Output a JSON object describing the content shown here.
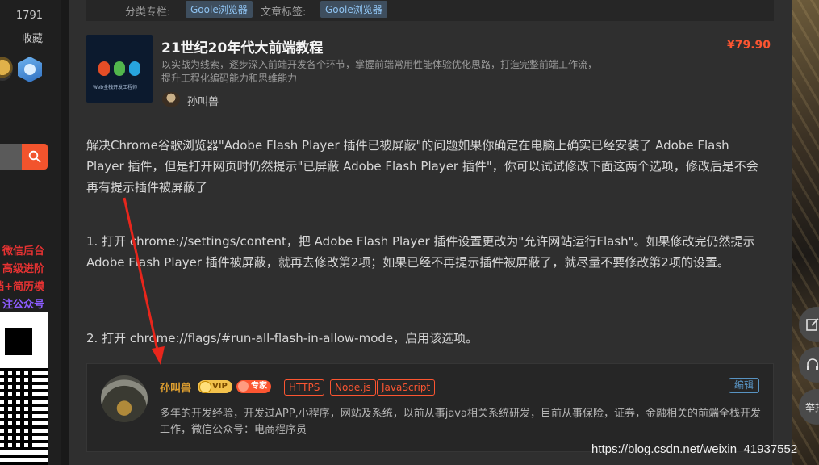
{
  "sidebar": {
    "stat_number": "1791",
    "stat_label": "收藏",
    "promos": [
      "微信后台",
      "高级进阶",
      "档+简历模",
      "注公众号"
    ]
  },
  "article_meta": {
    "category_label": "分类专栏:",
    "category_tag": "Goole浏览器",
    "tags_label": "文章标签:",
    "tag": "Goole浏览器"
  },
  "course": {
    "thumb_caption": "Web全栈开发工程师",
    "title": "21世纪20年代大前端教程",
    "price": "¥79.90",
    "description": "以实战为线索，逐步深入前端开发各个环节，掌握前端常用性能体验优化思路，打造完整前端工作流，提升工程化编码能力和思维能力",
    "author": "孙叫兽"
  },
  "article": {
    "intro": "解决Chrome谷歌浏览器\"Adobe Flash Player 插件已被屏蔽\"的问题如果你确定在电脑上确实已经安装了 Adobe Flash Player 插件，但是打开网页时仍然提示\"已屏蔽 Adobe Flash Player 插件\"，你可以试试修改下面这两个选项，修改后是不会再有提示插件被屏蔽了",
    "step1": "1. 打开 chrome://settings/content，把 Adobe Flash Player 插件设置更改为\"允许网站运行Flash\"。如果修改完仍然提示 Adobe Flash Player 插件被屏蔽，就再去修改第2项；如果已经不再提示插件被屏蔽了，就尽量不要修改第2项的设置。",
    "step2": "2. 打开 chrome://flags/#run-all-flash-in-allow-mode，启用该选项。"
  },
  "author_box": {
    "name": "孙叫兽",
    "vip_badge": "VIP",
    "expert_badge": "专家",
    "skills": [
      "HTTPS",
      "Node.js",
      "JavaScript"
    ],
    "edit_label": "编辑",
    "bio": "多年的开发经验，开发过APP,小程序，网站及系统，以前从事java相关系统研发，目前从事保险，证券，金融相关的前端全栈开发工作，微信公众号：电商程序员"
  },
  "tools": {
    "report_label": "举报"
  },
  "watermark": "https://blog.csdn.net/weixin_41937552",
  "colors": {
    "accent": "#fc5531",
    "link": "#5893c2",
    "arrow": "#e8261c"
  }
}
